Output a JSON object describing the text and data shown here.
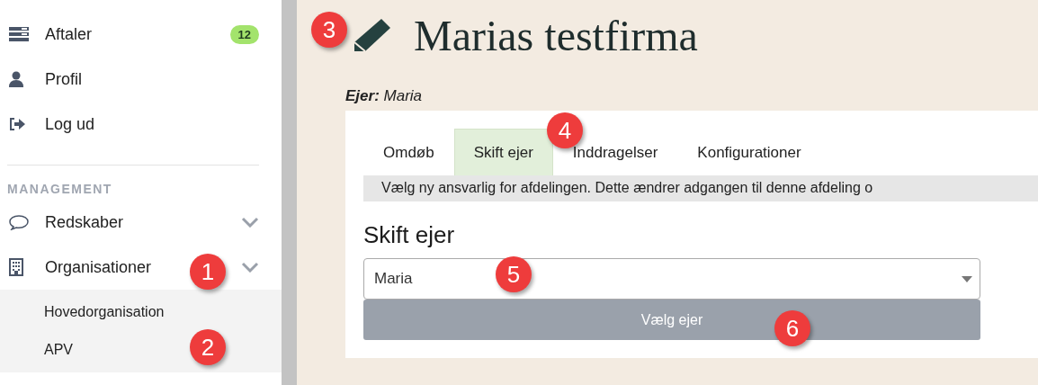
{
  "sidebar": {
    "items": [
      {
        "kind": "list",
        "label": "Aftaler",
        "badge": "12"
      },
      {
        "kind": "user",
        "label": "Profil"
      },
      {
        "kind": "logout",
        "label": "Log ud"
      }
    ],
    "section_title": "MANAGEMENT",
    "section_items": [
      {
        "kind": "chat",
        "label": "Redskaber"
      },
      {
        "kind": "building",
        "label": "Organisationer",
        "children": [
          {
            "label": "Hovedorganisation"
          },
          {
            "label": "APV"
          }
        ]
      }
    ]
  },
  "page": {
    "title": "Marias testfirma",
    "owner_label": "Ejer:",
    "owner": "Maria",
    "tabs": [
      {
        "label": "Omdøb",
        "selected": false
      },
      {
        "label": "Skift ejer",
        "selected": true
      },
      {
        "label": "Inddragelser",
        "selected": false
      },
      {
        "label": "Konfigurationer",
        "selected": false
      }
    ],
    "info": "Vælg ny ansvarlig for afdelingen. Dette ændrer adgangen til denne afdeling o",
    "heading": "Skift ejer",
    "select_value": "Maria",
    "button": "Vælg ejer"
  },
  "callouts": [
    {
      "label": "1"
    },
    {
      "label": "2"
    },
    {
      "label": "3"
    },
    {
      "label": "4"
    },
    {
      "label": "5"
    },
    {
      "label": "6"
    }
  ]
}
